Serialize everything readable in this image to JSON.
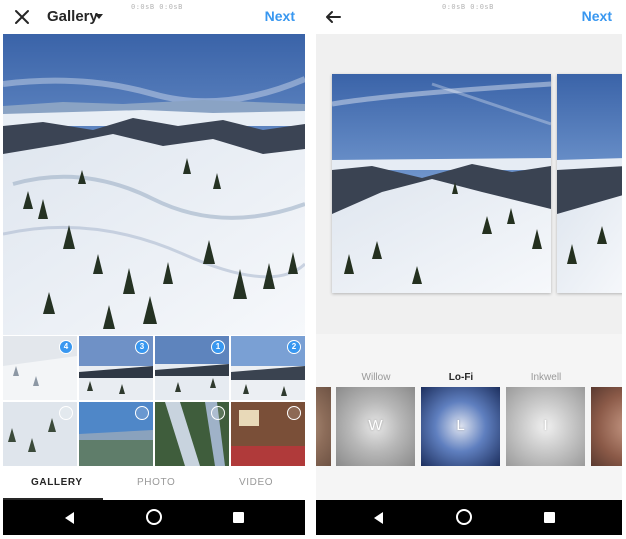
{
  "left_screen": {
    "status_text": "0:0sB   0:0sB",
    "title": "Gallery",
    "next_label": "Next",
    "thumbnails": [
      {
        "badge": "4"
      },
      {
        "badge": "3"
      },
      {
        "badge": "1"
      },
      {
        "badge": "2"
      },
      {
        "badge": ""
      },
      {
        "badge": ""
      },
      {
        "badge": ""
      },
      {
        "badge": ""
      }
    ],
    "tabs": [
      "GALLERY",
      "PHOTO",
      "VIDEO"
    ],
    "active_tab": "GALLERY"
  },
  "right_screen": {
    "status_text": "0:0sB   0:0sB",
    "next_label": "Next",
    "filters": [
      {
        "name": "",
        "letter": ""
      },
      {
        "name": "Willow",
        "letter": "W"
      },
      {
        "name": "Lo-Fi",
        "letter": "L"
      },
      {
        "name": "Inkwell",
        "letter": "I"
      },
      {
        "name": "",
        "letter": ""
      }
    ],
    "active_filter": "Lo-Fi"
  },
  "icons": {
    "close": "close-icon",
    "dropdown": "chevron-down-icon",
    "back": "arrow-back-icon",
    "nav_back": "nav-back-icon",
    "nav_home": "nav-home-icon",
    "nav_recent": "nav-recent-icon"
  },
  "colors": {
    "accent": "#3897f0",
    "text": "#262626",
    "muted": "#999999",
    "navbar": "#000000"
  }
}
